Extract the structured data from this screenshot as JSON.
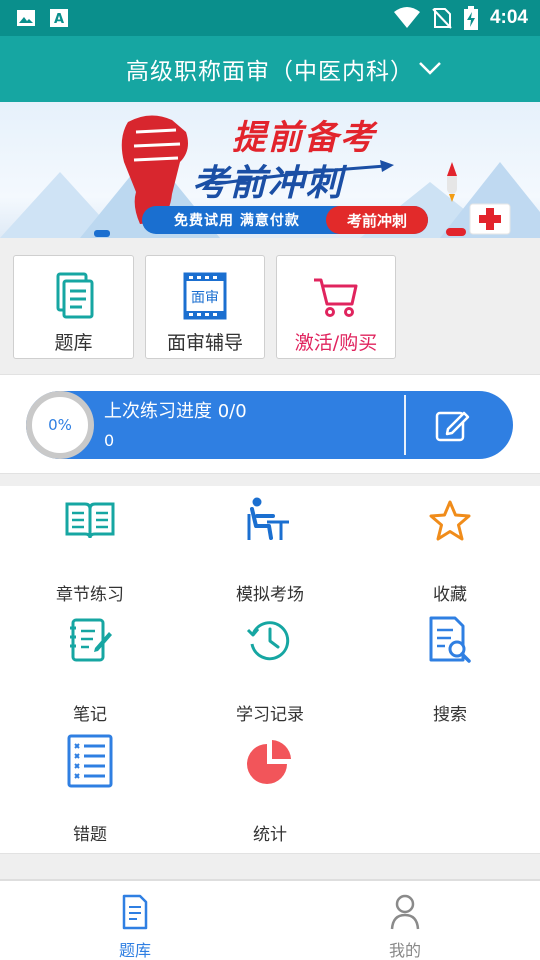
{
  "status_bar": {
    "time": "4:04",
    "left_icons": [
      "image-icon",
      "text-a-icon"
    ],
    "right_icons": [
      "wifi-icon",
      "no-sim-icon",
      "battery-charging-icon"
    ]
  },
  "header": {
    "title": "高级职称面审（中医内科）",
    "dropdown_icon": "chevron-down-icon",
    "background": "#16a6a2"
  },
  "banner": {
    "title1": "提前备考",
    "title2": "考前冲刺",
    "strip_text": "免费试用   满意付款",
    "strip_highlight": "考前冲刺"
  },
  "shortcuts": [
    {
      "label": "题库",
      "icon": "question-bank-icon",
      "color": "#16a6a2"
    },
    {
      "label": "面审辅导",
      "icon": "interview-film-icon",
      "color": "#1b6fd0"
    },
    {
      "label": "激活/购买",
      "icon": "shopping-cart-icon",
      "color": "#e0245e"
    }
  ],
  "progress": {
    "percent_label": "0%",
    "percent_value": 0,
    "title": "上次练习进度 0/0",
    "subtitle": "0",
    "edit_icon": "edit-icon",
    "bar_color": "#2f7fe2"
  },
  "grid": [
    {
      "label": "章节练习",
      "icon": "open-book-icon"
    },
    {
      "label": "模拟考场",
      "icon": "exam-desk-icon"
    },
    {
      "label": "收藏",
      "icon": "star-icon"
    },
    {
      "label": "笔记",
      "icon": "notepad-icon"
    },
    {
      "label": "学习记录",
      "icon": "history-clock-icon"
    },
    {
      "label": "搜索",
      "icon": "document-search-icon"
    },
    {
      "label": "错题",
      "icon": "wrong-list-icon"
    },
    {
      "label": "统计",
      "icon": "pie-chart-icon"
    }
  ],
  "bottom_nav": [
    {
      "label": "题库",
      "icon": "document-icon",
      "active": true,
      "color": "#2f7fe2"
    },
    {
      "label": "我的",
      "icon": "person-icon",
      "active": false,
      "color": "#888888"
    }
  ]
}
